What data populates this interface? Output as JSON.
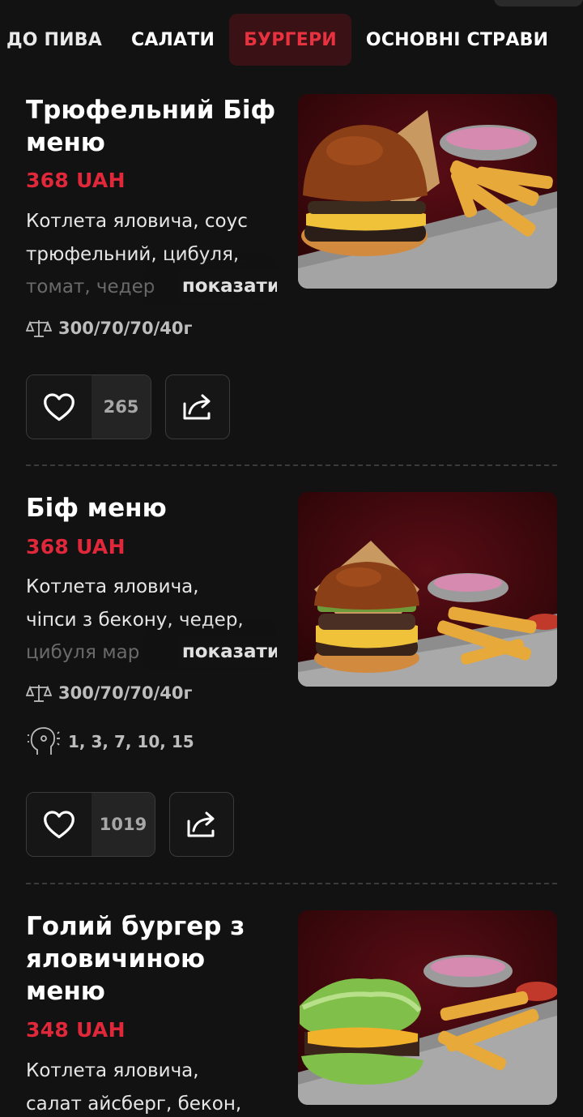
{
  "categories": {
    "items": [
      "ДО ПИВА",
      "САЛАТИ",
      "БУРГЕРИ",
      "ОСНОВНІ СТРАВИ"
    ],
    "active_index": 2
  },
  "colors": {
    "background": "#121212",
    "accent": "#e0283a",
    "active_tab_bg": "#3a1215"
  },
  "currency": "UAH",
  "show_more_label": "показати",
  "dishes": [
    {
      "title": "Трюфельний Біф меню",
      "price": "368 UAH",
      "description_lines": [
        "Котлета яловича, соус",
        "трюфельний, цибуля,",
        "томат, чедер"
      ],
      "weight": "300/70/70/40г",
      "allergens": "",
      "likes": "265"
    },
    {
      "title": "Біф меню",
      "price": "368 UAH",
      "description_lines": [
        "Котлета яловича,",
        "чіпси з бекону, чедер,",
        "цибуля мар"
      ],
      "weight": "300/70/70/40г",
      "allergens": "1, 3, 7, 10, 15",
      "likes": "1019"
    },
    {
      "title": "Голий бургер з яловичиною меню",
      "price": "348 UAH",
      "description_lines": [
        "Котлета яловича,",
        "салат айсберг, бекон,"
      ],
      "weight": "",
      "allergens": "",
      "likes": ""
    }
  ]
}
